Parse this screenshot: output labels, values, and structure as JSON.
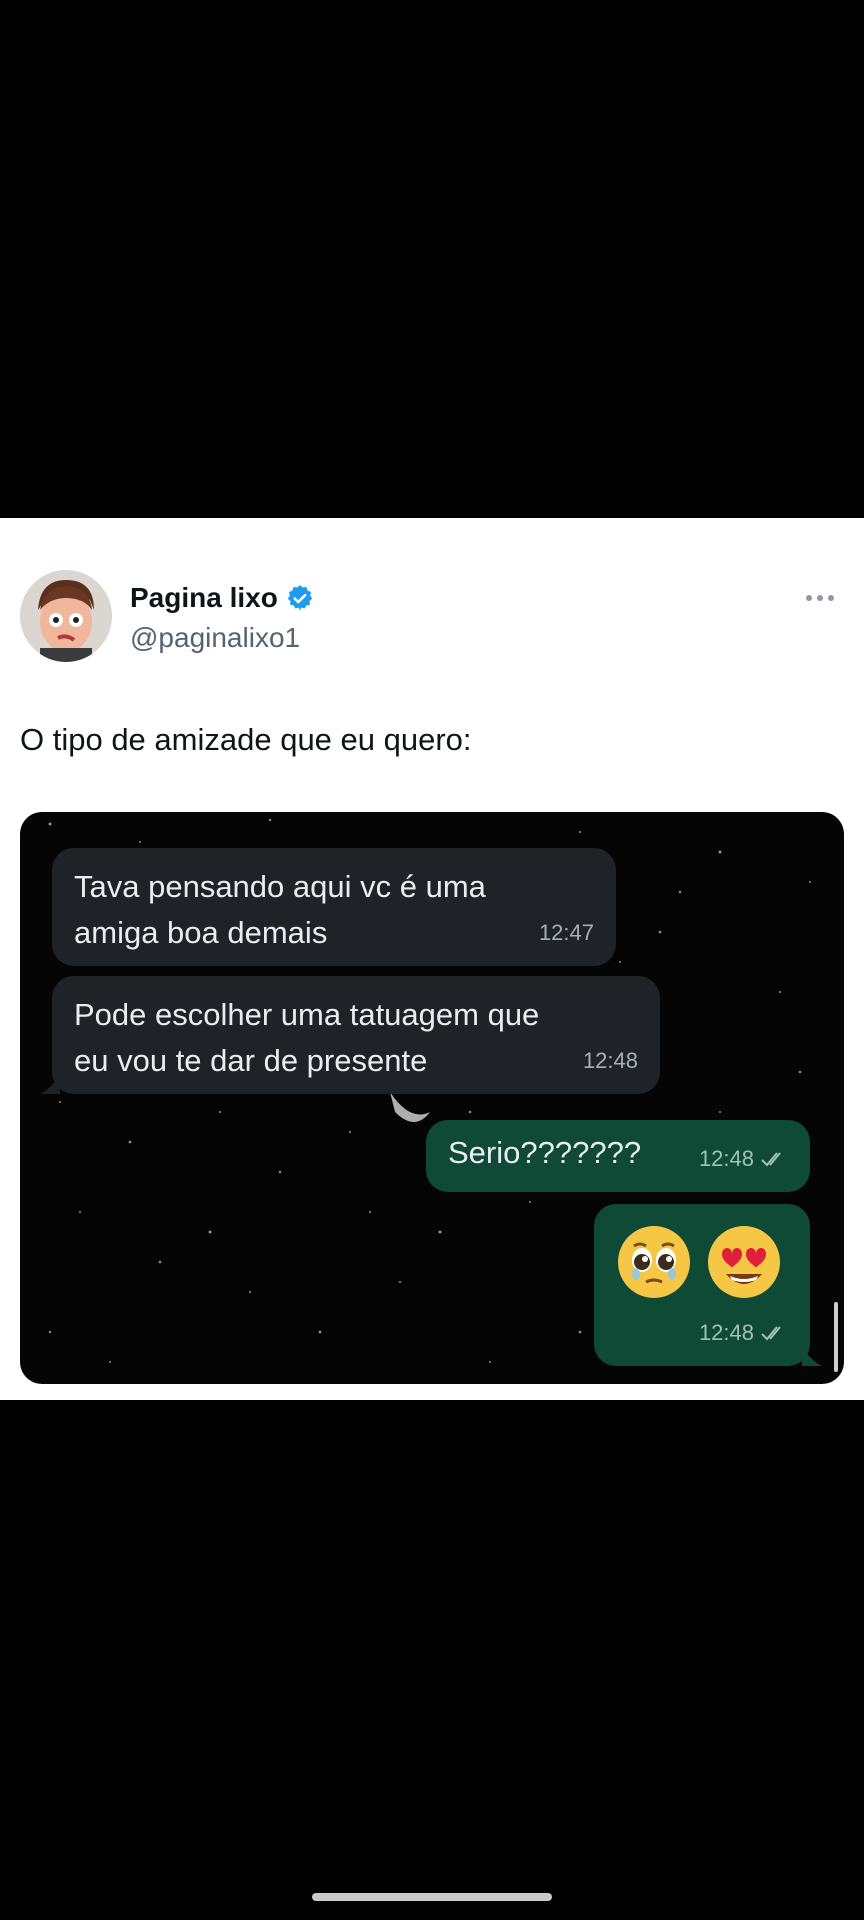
{
  "tweet": {
    "author_name": "Pagina lixo",
    "handle": "@paginalixo1",
    "text": "O tipo de amizade que eu quero:",
    "verified_icon": "verified-badge-icon",
    "more_icon": "more-options-icon"
  },
  "chat": {
    "messages": [
      {
        "direction": "incoming",
        "text": "Tava pensando aqui vc é uma\namiga boa demais",
        "time": "12:47"
      },
      {
        "direction": "incoming",
        "text": "Pode escolher uma tatuagem que\neu vou te dar de presente",
        "time": "12:48"
      },
      {
        "direction": "outgoing",
        "text": "Serio???????",
        "time": "12:48",
        "status": "read-check-icon"
      },
      {
        "direction": "outgoing",
        "emojis": [
          "pleading-face-emoji",
          "heart-eyes-emoji"
        ],
        "time": "12:48",
        "status": "read-check-icon"
      }
    ]
  },
  "colors": {
    "incoming_bubble": "#1f2327",
    "outgoing_bubble": "#0e4a36",
    "verified_blue": "#1d9bf0"
  }
}
